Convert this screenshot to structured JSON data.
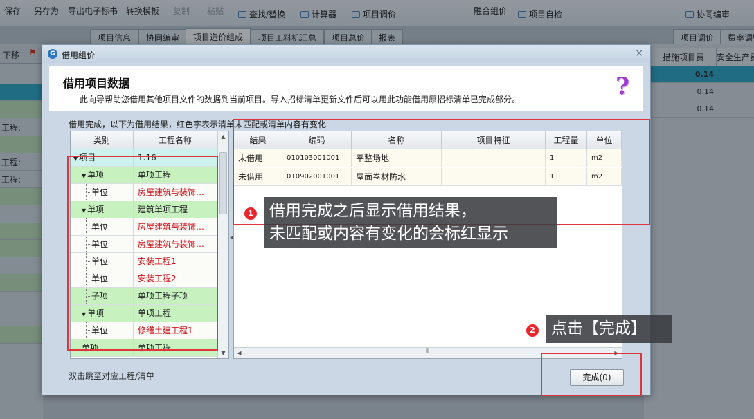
{
  "app": {
    "toolbar": [
      {
        "label": "保存",
        "disabled": false
      },
      {
        "label": "另存为",
        "disabled": false
      },
      {
        "label": "导出电子标书",
        "disabled": false
      },
      {
        "label": "转换模板",
        "disabled": false
      },
      {
        "label": "复制",
        "disabled": true
      },
      {
        "label": "粘贴",
        "disabled": true
      },
      {
        "label": "查找/替换",
        "disabled": false
      },
      {
        "label": "计算器",
        "disabled": false
      },
      {
        "label": "项目调价",
        "disabled": false
      },
      {
        "label": "融合组价",
        "disabled": false
      },
      {
        "label": "项目自检",
        "disabled": false
      },
      {
        "label": "协同编审",
        "disabled": false
      }
    ],
    "tabs": [
      "项目信息",
      "协同编审",
      "项目造价组成",
      "项目工料机汇总",
      "项目总价",
      "报表"
    ],
    "right_tabs": [
      "项目调价",
      "费率调整"
    ],
    "left_toolbar_label": "下移",
    "left_rows": [
      "工程:",
      "工程:",
      "工程:"
    ],
    "right_headers": [
      "措施项目费",
      "安全生产费"
    ],
    "right_values": [
      "0.14",
      "0.14",
      "0.14"
    ]
  },
  "dialog": {
    "title": "借用组价",
    "header_title": "借用项目数据",
    "header_desc": "此向导帮助您借用其他项目文件的数据到当前项目。导入招标清单更新文件后可以用此功能借用原招标清单已完成部分。",
    "help_icon": "?",
    "info_line": "借用完成，以下为借用结果，红色字表示清单未匹配或清单内容有变化",
    "bottom_tip": "双击跳至对应工程/清单",
    "finish_label": "完成(0)",
    "close_icon": "×"
  },
  "tree": {
    "columns": [
      "类别",
      "工程名称"
    ],
    "rows": [
      {
        "type": "项目",
        "name": "1.16",
        "level": 0,
        "expand": true,
        "red": false,
        "bg": "cyan"
      },
      {
        "type": "单项",
        "name": "单项工程",
        "level": 1,
        "expand": true,
        "red": false,
        "bg": "green"
      },
      {
        "type": "单位",
        "name": "房屋建筑与装饰…",
        "level": 2,
        "expand": false,
        "red": true,
        "bg": "white"
      },
      {
        "type": "单项",
        "name": "建筑单项工程",
        "level": 1,
        "expand": true,
        "red": false,
        "bg": "green"
      },
      {
        "type": "单位",
        "name": "房屋建筑与装饰…",
        "level": 2,
        "expand": false,
        "red": true,
        "bg": "white"
      },
      {
        "type": "单位",
        "name": "房屋建筑与装饰…",
        "level": 2,
        "expand": false,
        "red": true,
        "bg": "white"
      },
      {
        "type": "单位",
        "name": "安装工程1",
        "level": 2,
        "expand": false,
        "red": true,
        "bg": "white"
      },
      {
        "type": "单位",
        "name": "安装工程2",
        "level": 2,
        "expand": false,
        "red": true,
        "bg": "white"
      },
      {
        "type": "子项",
        "name": "单项工程子项",
        "level": 2,
        "expand": false,
        "red": false,
        "bg": "green"
      },
      {
        "type": "单项",
        "name": "单项工程",
        "level": 1,
        "expand": true,
        "red": false,
        "bg": "green"
      },
      {
        "type": "单位",
        "name": "修缮土建工程1",
        "level": 2,
        "expand": false,
        "red": true,
        "bg": "white"
      },
      {
        "type": "单项",
        "name": "单项工程",
        "level": 1,
        "expand": false,
        "red": false,
        "bg": "green"
      }
    ]
  },
  "result": {
    "columns": [
      "结果",
      "编码",
      "名称",
      "项目特征",
      "工程量",
      "单位"
    ],
    "rows": [
      {
        "result": "未借用",
        "code": "010103001001",
        "name": "平整场地",
        "feature": "",
        "qty": "1",
        "unit": "m2"
      },
      {
        "result": "未借用",
        "code": "010902001001",
        "name": "屋面卷材防水",
        "feature": "",
        "qty": "1",
        "unit": "m2"
      }
    ]
  },
  "annotations": {
    "badge1": "1",
    "callout1_line1": "借用完成之后显示借用结果，",
    "callout1_line2": "未匹配或内容有变化的会标红显示",
    "badge2": "2",
    "callout2": "点击【完成】",
    "accent_color": "#e0353a"
  }
}
